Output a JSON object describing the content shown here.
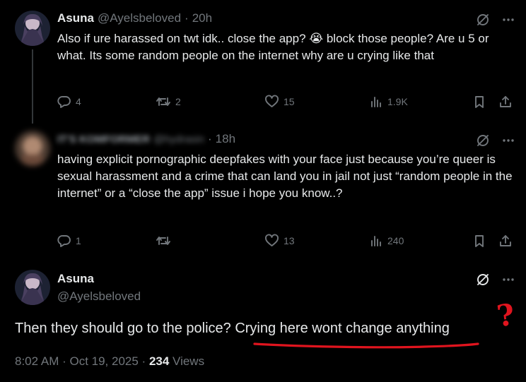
{
  "tweet1": {
    "name": "Asuna",
    "handle": "@Ayelsbeloved",
    "time": "20h",
    "text": "Also if ure harassed on twt idk.. close the app? 😭 block those people? Are u 5 or what. Its some random people on the internet why are u crying like that",
    "replies": "4",
    "reposts": "2",
    "likes": "15",
    "views": "1.9K"
  },
  "tweet2": {
    "name": "IT'S KOMFORMER",
    "handle": "@hydrasin",
    "time": "18h",
    "text": "having explicit pornographic deepfakes with your face just because you’re queer is sexual harassment and a crime that can land you in jail not just “random people in the internet” or a “close the app” issue i hope you know..?",
    "replies": "1",
    "reposts": "",
    "likes": "13",
    "views": "240"
  },
  "main_tweet": {
    "name": "Asuna",
    "handle": "@Ayelsbeloved",
    "text_plain": "Then they should go to the police? ",
    "text_underlined": "Crying here wont change anything",
    "annotation": "?",
    "timestamp": "8:02 AM · Oct 19, 2025 · ",
    "views_count": "234",
    "views_label": " Views"
  },
  "colors": {
    "background": "#000000",
    "text": "#e7e9ea",
    "muted": "#71767b",
    "annotation_red": "#e0141e"
  },
  "icons": [
    "grok-icon",
    "more-icon",
    "reply-icon",
    "repost-icon",
    "like-icon",
    "views-icon",
    "bookmark-icon",
    "share-icon"
  ]
}
